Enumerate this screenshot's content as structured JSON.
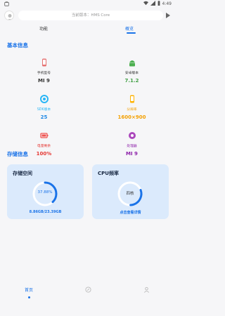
{
  "status_bar": {
    "time": "4:49"
  },
  "top_bar": {
    "notice": "当前版本：HMS Core"
  },
  "tabs": {
    "function": "功能",
    "overview": "概览"
  },
  "basic_info": {
    "title": "基本信息",
    "items": [
      {
        "label": "手机型号",
        "value": "MI 9",
        "icon": "phone-icon",
        "color": "#e57373",
        "value_color": "#333333"
      },
      {
        "label": "安卓版本",
        "value": "7.1.2",
        "icon": "android-icon",
        "color": "#4caf50",
        "value_color": "#43a047"
      },
      {
        "label": "SDK版本",
        "value": "25",
        "icon": "sdk-icon",
        "color": "#29b6f6",
        "value_color": "#1e88e5"
      },
      {
        "label": "分辨率",
        "value": "1600×900",
        "icon": "resolution-icon",
        "color": "#ffb300",
        "value_color": "#f4a000"
      },
      {
        "label": "电量剩余",
        "value": "100%",
        "icon": "battery-icon",
        "color": "#ef5350",
        "value_color": "#e53935"
      },
      {
        "label": "处理器",
        "value": "MI 9",
        "icon": "processor-icon",
        "color": "#ab47bc",
        "value_color": "#8e24aa"
      }
    ]
  },
  "storage_info": {
    "title": "存储信息",
    "storage_card": {
      "title": "存储空间",
      "percent_text": "37.88%",
      "percent": 0.3788,
      "detail": "8.86GB/23.39GB"
    },
    "cpu_card": {
      "title": "CPU频率",
      "center_text": "四核",
      "detail": "点击查看详情"
    }
  },
  "bottom_nav": {
    "home": "首页"
  },
  "colors": {
    "accent": "#1a73e8",
    "card_bg": "#dbeafc",
    "background": "#f6f6f8"
  }
}
